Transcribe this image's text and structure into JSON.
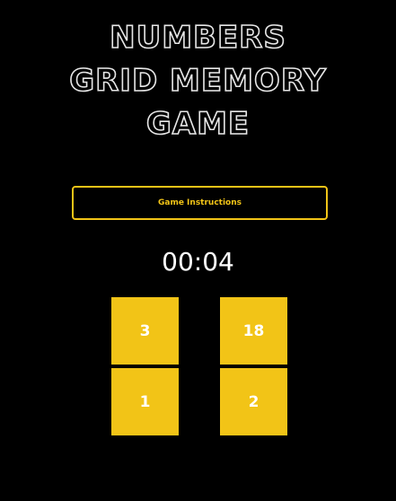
{
  "game": {
    "title_lines": [
      "NUMBERS",
      "GRID MEMORY",
      "GAME"
    ],
    "instructions_label": "Game Instructions",
    "timer": "00:04",
    "cards": [
      {
        "value": "3"
      },
      {
        "value": "18"
      },
      {
        "value": "1"
      },
      {
        "value": "2"
      }
    ]
  },
  "colors": {
    "background": "#000000",
    "accent": "#f2c417",
    "card_text": "#ffffff",
    "title_outline": "#e6e6e6"
  }
}
